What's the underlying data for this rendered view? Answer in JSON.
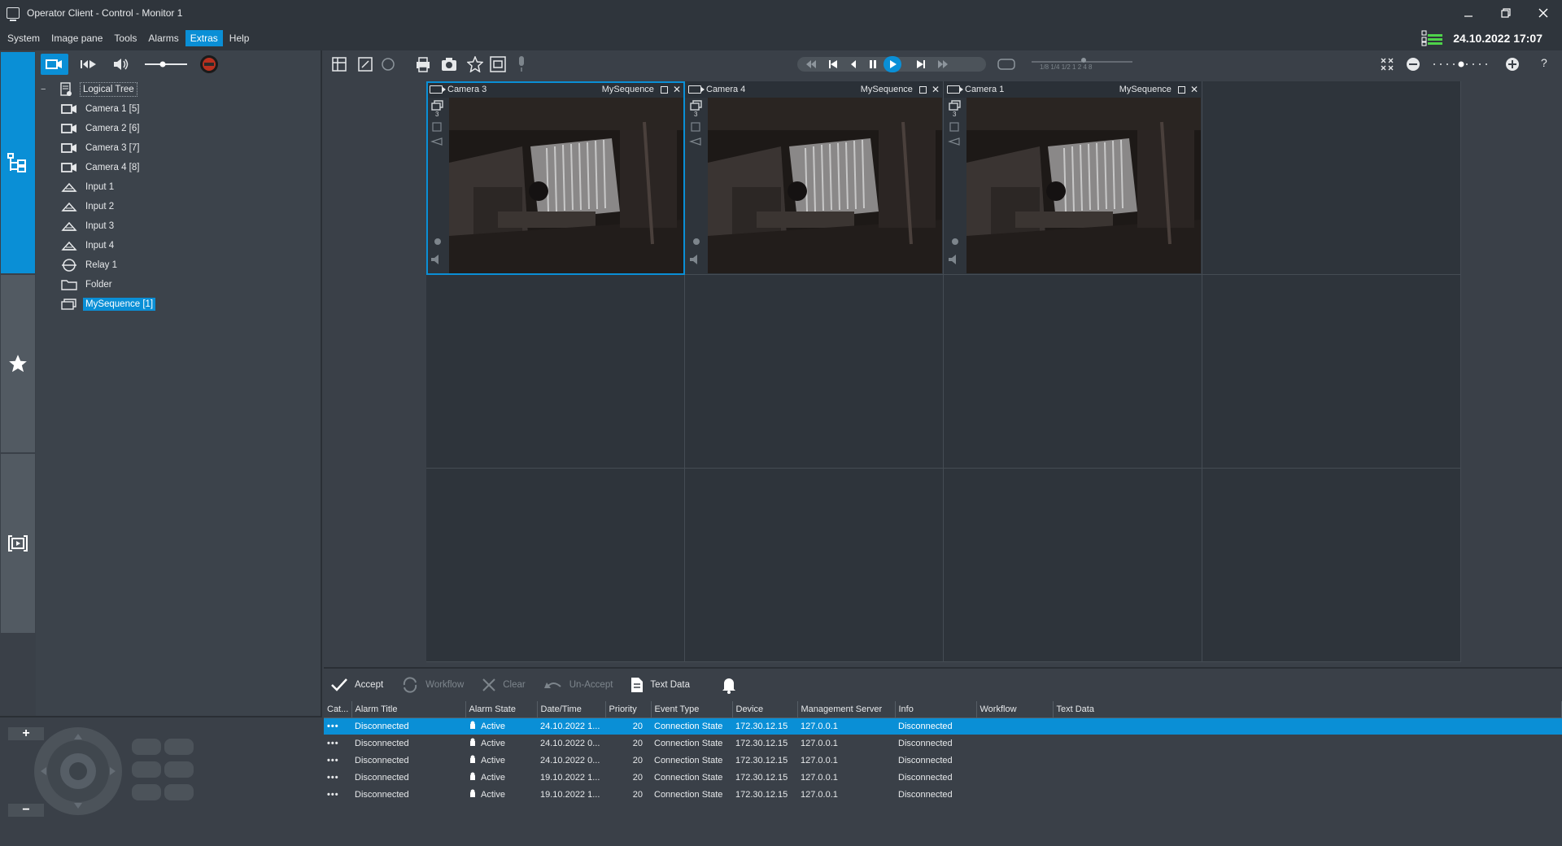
{
  "window": {
    "title": "Operator Client - Control - Monitor 1"
  },
  "menu": [
    "System",
    "Image pane",
    "Tools",
    "Alarms",
    "Extras",
    "Help"
  ],
  "menu_active": "Extras",
  "clock": "24.10.2022 17:07",
  "tree": {
    "root": "Logical Tree",
    "items": [
      {
        "label": "Camera 1 [5]",
        "icon": "camera-icon"
      },
      {
        "label": "Camera 2 [6]",
        "icon": "camera-icon"
      },
      {
        "label": "Camera 3 [7]",
        "icon": "camera-icon"
      },
      {
        "label": "Camera 4 [8]",
        "icon": "camera-icon"
      },
      {
        "label": "Input 1",
        "icon": "input-icon"
      },
      {
        "label": "Input 2",
        "icon": "input-icon"
      },
      {
        "label": "Input 3",
        "icon": "input-icon"
      },
      {
        "label": "Input 4",
        "icon": "input-icon"
      },
      {
        "label": "Relay 1",
        "icon": "relay-icon"
      },
      {
        "label": "Folder",
        "icon": "folder-icon"
      },
      {
        "label": "MySequence [1]",
        "icon": "sequence-icon",
        "selected": true
      }
    ]
  },
  "cameras": [
    {
      "name": "Camera 3",
      "sequence": "MySequence",
      "sequence_count": "3",
      "selected": true
    },
    {
      "name": "Camera 4",
      "sequence": "MySequence",
      "sequence_count": "3",
      "selected": false
    },
    {
      "name": "Camera 1",
      "sequence": "MySequence",
      "sequence_count": "3",
      "selected": false
    }
  ],
  "playback": {
    "speeds": "1/8 1/4 1/2 1 2 4 8"
  },
  "alarm_toolbar": {
    "accept": "Accept",
    "workflow": "Workflow",
    "clear": "Clear",
    "unaccept": "Un-Accept",
    "text_data": "Text Data"
  },
  "alarm_table": {
    "columns": [
      "Cat...",
      "Alarm Title",
      "Alarm State",
      "Date/Time",
      "Priority",
      "Event Type",
      "Device",
      "Management Server",
      "Info",
      "Workflow",
      "Text Data"
    ],
    "rows": [
      {
        "cat": "•••",
        "title": "Disconnected",
        "state": "Active",
        "datetime": "24.10.2022 1...",
        "priority": "20",
        "event": "Connection State",
        "device": "172.30.12.15",
        "server": "127.0.0.1",
        "info": "Disconnected",
        "workflow": "",
        "text": "",
        "selected": true
      },
      {
        "cat": "•••",
        "title": "Disconnected",
        "state": "Active",
        "datetime": "24.10.2022 0...",
        "priority": "20",
        "event": "Connection State",
        "device": "172.30.12.15",
        "server": "127.0.0.1",
        "info": "Disconnected",
        "workflow": "",
        "text": ""
      },
      {
        "cat": "•••",
        "title": "Disconnected",
        "state": "Active",
        "datetime": "24.10.2022 0...",
        "priority": "20",
        "event": "Connection State",
        "device": "172.30.12.15",
        "server": "127.0.0.1",
        "info": "Disconnected",
        "workflow": "",
        "text": ""
      },
      {
        "cat": "•••",
        "title": "Disconnected",
        "state": "Active",
        "datetime": "19.10.2022 1...",
        "priority": "20",
        "event": "Connection State",
        "device": "172.30.12.15",
        "server": "127.0.0.1",
        "info": "Disconnected",
        "workflow": "",
        "text": ""
      },
      {
        "cat": "•••",
        "title": "Disconnected",
        "state": "Active",
        "datetime": "19.10.2022 1...",
        "priority": "20",
        "event": "Connection State",
        "device": "172.30.12.15",
        "server": "127.0.0.1",
        "info": "Disconnected",
        "workflow": "",
        "text": ""
      }
    ]
  },
  "colors": {
    "accent": "#0a8fd6",
    "status_green": "#4fd34a",
    "background": "#3a4048"
  }
}
